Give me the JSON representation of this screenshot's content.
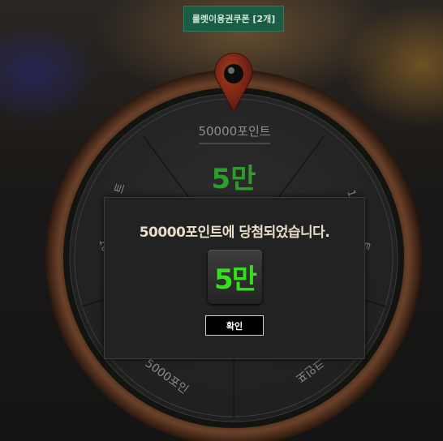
{
  "coupon_button": {
    "label": "룰렛이용권쿠폰 [2개]"
  },
  "wheel": {
    "top_segment": {
      "label": "50000포인트",
      "amount": "5만"
    },
    "partial_labels": {
      "upper_left": "트",
      "left": "100",
      "upper_right": "10",
      "right": "트",
      "lower_left": "5000포인",
      "lower_right": "크인포"
    }
  },
  "dialog": {
    "message": "50000포인트에 당첨되었습니다.",
    "prize_label": "5만",
    "confirm_label": "확인"
  },
  "colors": {
    "prize_green": "#35e01d",
    "wheel_green": "#2d9e2a",
    "coupon_bg": "#1a5c44",
    "pointer_red": "#7a2414"
  }
}
